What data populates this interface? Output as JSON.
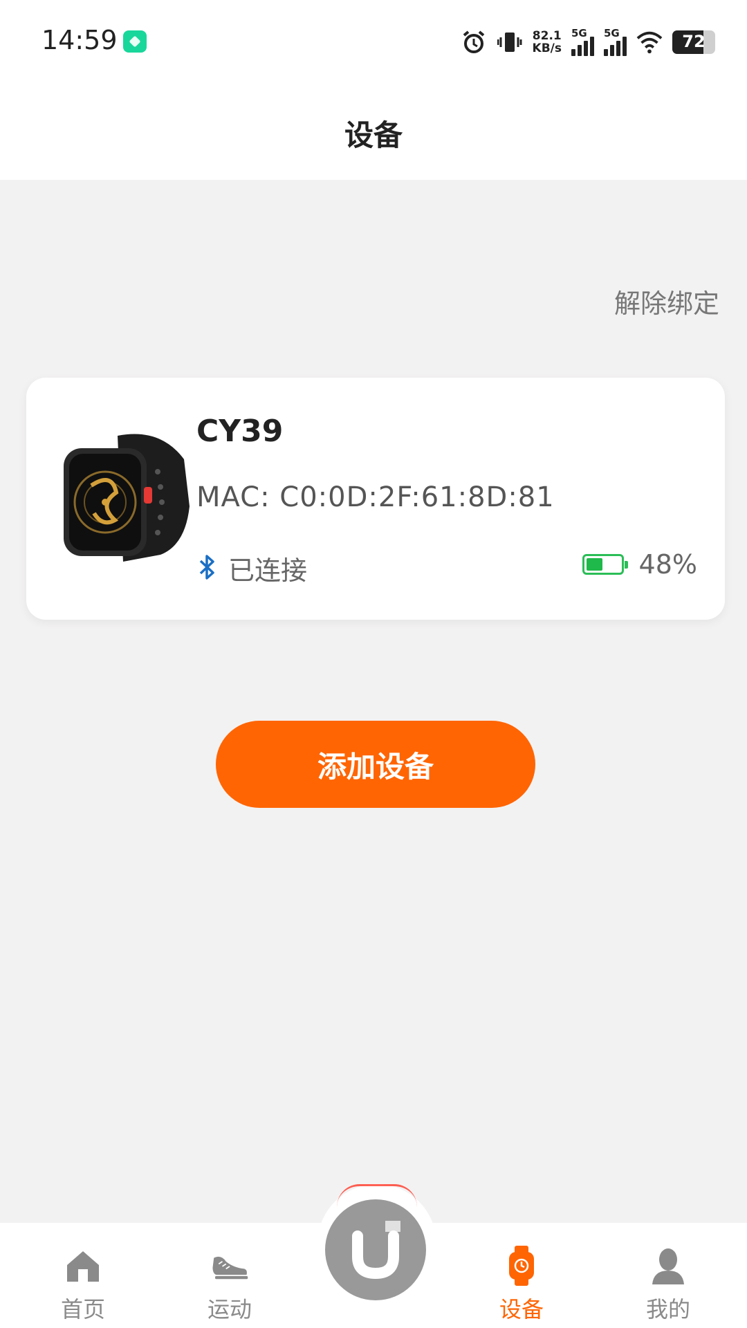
{
  "status_bar": {
    "time": "14:59",
    "net_speed_value": "82.1",
    "net_speed_unit": "KB/s",
    "signal1_label": "5G",
    "signal2_label": "5G",
    "battery_level": "72"
  },
  "header": {
    "title": "设备"
  },
  "unbind_label": "解除绑定",
  "device": {
    "name": "CY39",
    "mac": "MAC: C0:0D:2F:61:8D:81",
    "connection_status": "已连接",
    "battery_percent": "48%",
    "battery_fraction": 0.48
  },
  "add_device_label": "添加设备",
  "tabs": [
    {
      "label": "首页",
      "icon": "home-icon",
      "active": false
    },
    {
      "label": "运动",
      "icon": "shoe-icon",
      "active": false
    },
    {
      "label": "设备",
      "icon": "watch-icon",
      "active": true
    },
    {
      "label": "我的",
      "icon": "user-icon",
      "active": false
    }
  ],
  "colors": {
    "accent": "#ff6503",
    "background": "#f3f2f2",
    "battery_green": "#2bbd57",
    "bluetooth_blue": "#1a6fc4",
    "tab_inactive": "#8a8a8a"
  }
}
